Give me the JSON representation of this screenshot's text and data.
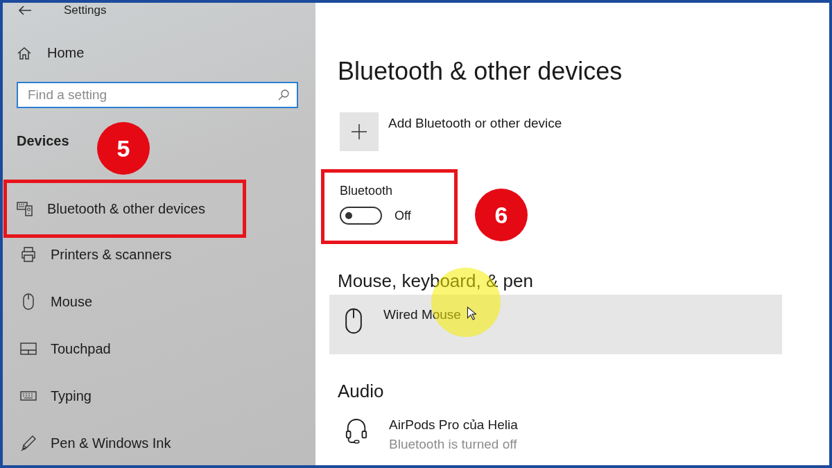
{
  "window": {
    "title": "Settings"
  },
  "sidebar": {
    "home": "Home",
    "search": {
      "placeholder": "Find a setting"
    },
    "section": "Devices",
    "items": [
      {
        "label": "Bluetooth & other devices",
        "kind": "bluetooth",
        "boxed": true
      },
      {
        "label": "Printers & scanners",
        "kind": "printer",
        "boxed": false
      },
      {
        "label": "Mouse",
        "kind": "mouse",
        "boxed": false
      },
      {
        "label": "Touchpad",
        "kind": "touchpad",
        "boxed": false
      },
      {
        "label": "Typing",
        "kind": "keyboard",
        "boxed": false
      },
      {
        "label": "Pen & Windows Ink",
        "kind": "pen",
        "boxed": false
      }
    ]
  },
  "page": {
    "title": "Bluetooth & other devices",
    "add_button": "Add Bluetooth or other device",
    "bluetooth": {
      "label": "Bluetooth",
      "on": false,
      "state": "Off",
      "boxed": true
    },
    "sections": [
      {
        "heading": "Mouse, keyboard, & pen",
        "devices": [
          {
            "name": "Wired Mouse",
            "kind": "mouse",
            "highlighted": true
          }
        ]
      },
      {
        "heading": "Audio",
        "devices": [
          {
            "name": "AirPods Pro của Helia",
            "status": "Bluetooth is turned off",
            "kind": "headset",
            "highlighted": false
          }
        ]
      }
    ]
  },
  "annotations": [
    {
      "number": "5"
    },
    {
      "number": "6"
    }
  ]
}
